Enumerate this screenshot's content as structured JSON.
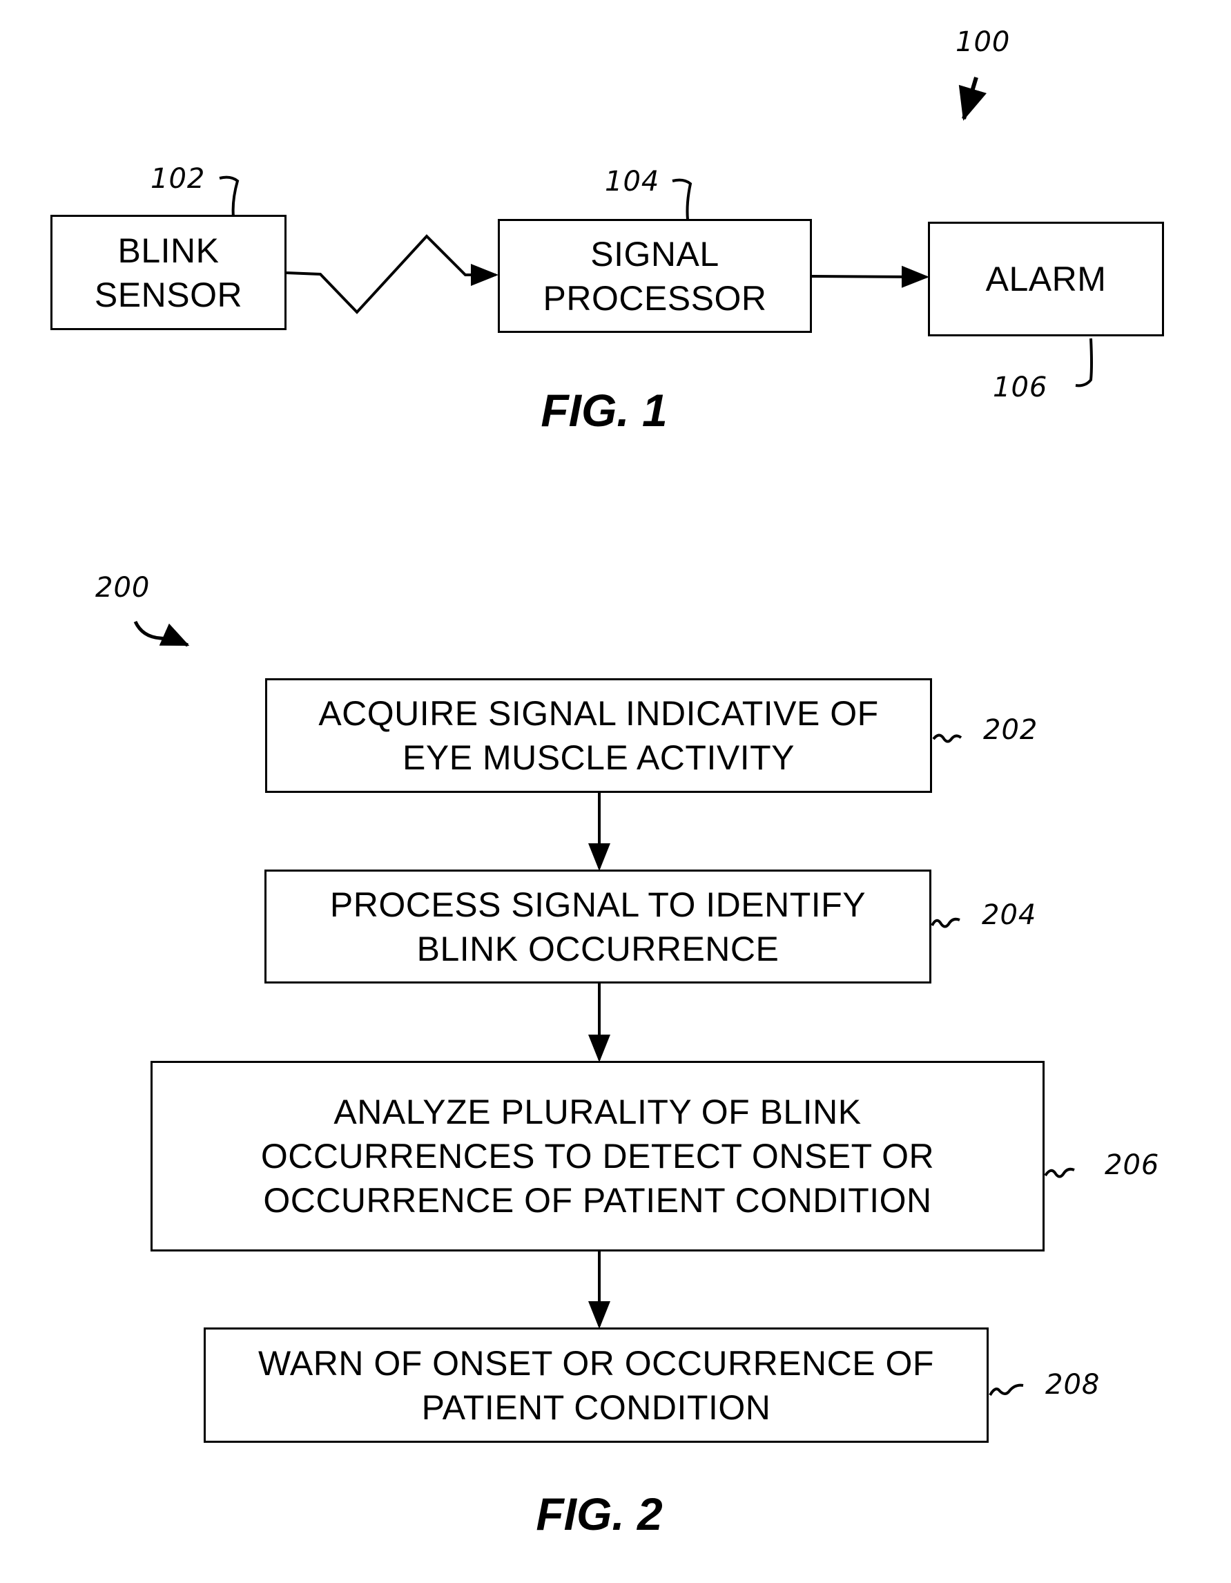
{
  "fig1": {
    "caption": "FIG. 1",
    "system_ref": "100",
    "blocks": [
      {
        "ref": "102",
        "label": "BLINK\nSENSOR"
      },
      {
        "ref": "104",
        "label": "SIGNAL\nPROCESSOR"
      },
      {
        "ref": "106",
        "label": "ALARM"
      }
    ],
    "connections": [
      {
        "from": "102",
        "to": "104",
        "type": "wireless"
      },
      {
        "from": "104",
        "to": "106",
        "type": "wired"
      }
    ]
  },
  "fig2": {
    "caption": "FIG. 2",
    "method_ref": "200",
    "steps": [
      {
        "ref": "202",
        "label": "ACQUIRE SIGNAL INDICATIVE OF\nEYE MUSCLE ACTIVITY"
      },
      {
        "ref": "204",
        "label": "PROCESS SIGNAL TO IDENTIFY\nBLINK OCCURRENCE"
      },
      {
        "ref": "206",
        "label": "ANALYZE PLURALITY OF BLINK\nOCCURRENCES TO DETECT ONSET OR\nOCCURRENCE OF PATIENT CONDITION"
      },
      {
        "ref": "208",
        "label": "WARN OF ONSET OR OCCURRENCE OF\nPATIENT CONDITION"
      }
    ]
  }
}
